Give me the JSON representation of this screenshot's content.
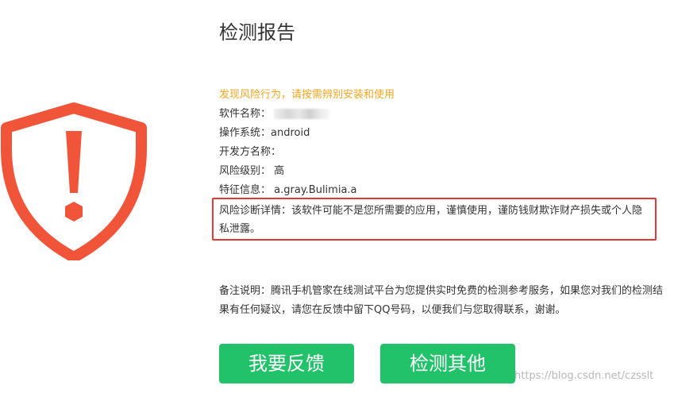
{
  "report": {
    "title": "检测报告",
    "warning": "发现风险行为，请按需辨别安装和使用",
    "software_name_label": "软件名称：",
    "os_label": "操作系统：",
    "os_value": "android",
    "developer_label": "开发方名称：",
    "developer_value": "",
    "risk_level_label": "风险级别：",
    "risk_level_value": "高",
    "signature_label": "特征信息：",
    "signature_value": "a.gray.Bulimia.a",
    "detail": "风险诊断详情：该软件可能不是您所需要的应用，谨慎使用，谨防钱财欺诈财产损失或个人隐私泄露。",
    "note": "备注说明：腾讯手机管家在线测试平台为您提供实时免费的检测参考服务，如果您对我们的检测结果有任何疑议，请您在反馈中留下QQ号码，以便我们与您取得联系，谢谢。"
  },
  "buttons": {
    "feedback": "我要反馈",
    "detect_other": "检测其他"
  },
  "watermark": "https://blog.csdn.net/czsslt",
  "icons": {
    "shield": "shield-alert-icon"
  },
  "colors": {
    "shield": "#f0553a",
    "warning_text": "#f5a623",
    "highlight_border": "#e53935",
    "button": "#22c26b"
  }
}
